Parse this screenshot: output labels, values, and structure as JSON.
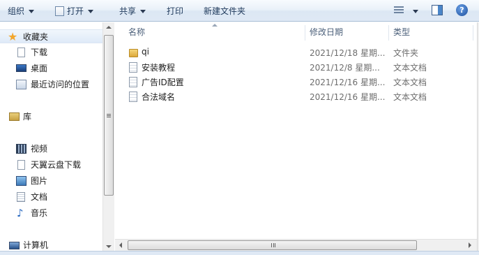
{
  "toolbar": {
    "organize": "组织",
    "open": "打开",
    "share": "共享",
    "print": "打印",
    "new_folder": "新建文件夹"
  },
  "nav": {
    "favorites": "收藏夹",
    "downloads": "下载",
    "desktop": "桌面",
    "recent": "最近访问的位置",
    "libraries": "库",
    "videos": "视频",
    "tianyi": "天翼云盘下载",
    "pictures": "图片",
    "documents": "文档",
    "music": "音乐",
    "computer": "计算机"
  },
  "columns": {
    "name": "名称",
    "date": "修改日期",
    "type": "类型"
  },
  "files": [
    {
      "name": "qi",
      "date": "2021/12/18 星期...",
      "type": "文件夹",
      "icon": "folder-icon"
    },
    {
      "name": "安装教程",
      "date": "2021/12/8 星期...",
      "type": "文本文档",
      "icon": "text-file-icon"
    },
    {
      "name": "广告ID配置",
      "date": "2021/12/16 星期...",
      "type": "文本文档",
      "icon": "text-file-icon"
    },
    {
      "name": "合法域名",
      "date": "2021/12/16 星期...",
      "type": "文本文档",
      "icon": "text-file-icon"
    }
  ],
  "colors": {
    "toolbar_text": "#1e395b",
    "header_text": "#4c607a",
    "secondary_text": "#6d6d6d"
  }
}
